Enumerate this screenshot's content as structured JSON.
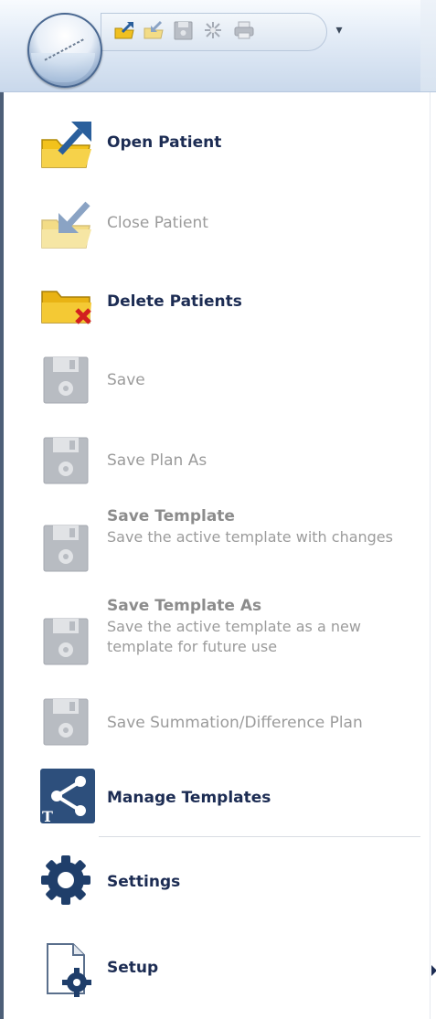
{
  "quick_access": {
    "icons": [
      "open-patient-icon",
      "close-patient-icon",
      "save-icon",
      "settings-sparkle-icon",
      "print-icon"
    ],
    "more_glyph": "▾"
  },
  "menu": {
    "items": [
      {
        "label": "Open Patient",
        "state": "enabled",
        "icon": "open-folder-icon"
      },
      {
        "label": "Close Patient",
        "state": "disabled",
        "icon": "close-folder-icon"
      },
      {
        "label": "Delete Patients",
        "state": "enabled",
        "icon": "delete-folder-icon"
      },
      {
        "label": "Save",
        "state": "disabled",
        "icon": "floppy-disk-icon"
      },
      {
        "label": "Save Plan As",
        "state": "disabled",
        "icon": "floppy-disk-icon"
      },
      {
        "label": "Save Template",
        "description": "Save the active template with changes",
        "state": "disabled",
        "icon": "floppy-disk-icon"
      },
      {
        "label": "Save Template As",
        "description": "Save the active template as a new template for future use",
        "state": "disabled",
        "icon": "floppy-disk-icon"
      },
      {
        "label": "Save Summation/Difference Plan",
        "state": "disabled",
        "icon": "floppy-disk-icon"
      },
      {
        "label": "Manage Templates",
        "state": "enabled",
        "icon": "share-template-icon"
      },
      {
        "label": "Settings",
        "state": "enabled",
        "icon": "gear-icon"
      },
      {
        "label": "Setup",
        "state": "enabled",
        "has_submenu": true,
        "icon": "document-gear-icon"
      }
    ]
  },
  "colors": {
    "enabled_text": "#1c2c53",
    "disabled_text": "#9b9b9b",
    "folder_yellow": "#f2c21c",
    "blue_arrow": "#2a5f9c",
    "red_x": "#d21f1f",
    "floppy_gray": "#b8bcc2",
    "gear_navy": "#1f3e6a"
  }
}
